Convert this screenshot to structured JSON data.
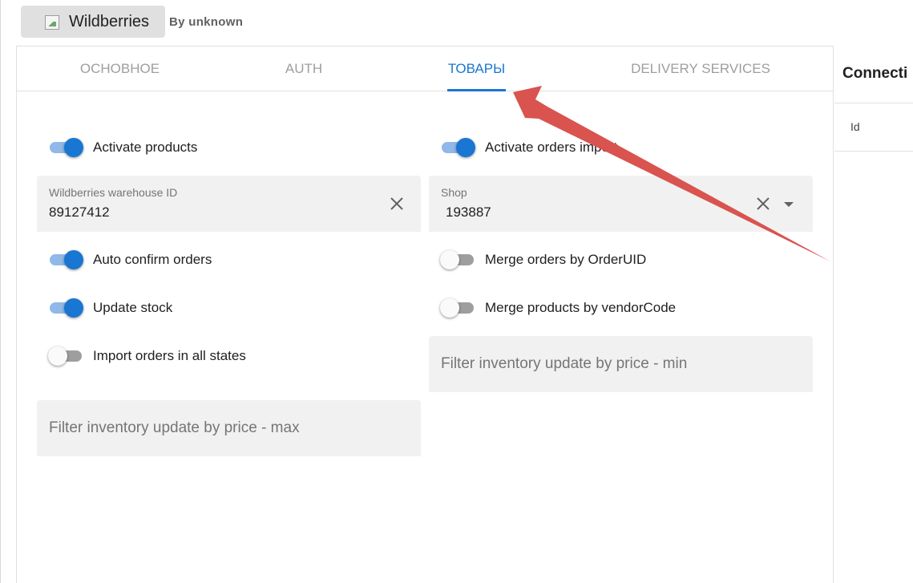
{
  "app": {
    "title": "Wildberries",
    "author": "By unknown"
  },
  "tabs": [
    {
      "label": "ОСНОВНОЕ",
      "active": false
    },
    {
      "label": "AUTH",
      "active": false
    },
    {
      "label": "ТОВАРЫ",
      "active": true
    },
    {
      "label": "DELIVERY SERVICES",
      "active": false
    }
  ],
  "toggles": {
    "activate_products": {
      "label": "Activate products",
      "on": true
    },
    "activate_orders_import": {
      "label": "Activate orders import",
      "on": true
    },
    "auto_confirm_orders": {
      "label": "Auto confirm orders",
      "on": true
    },
    "merge_orders_by_orderuid": {
      "label": "Merge orders by OrderUID",
      "on": false
    },
    "update_stock": {
      "label": "Update stock",
      "on": true
    },
    "merge_products_by_vendorcode": {
      "label": "Merge products by vendorCode",
      "on": false
    },
    "import_orders_all_states": {
      "label": "Import orders in all states",
      "on": false
    }
  },
  "fields": {
    "warehouse_id": {
      "label": "Wildberries warehouse ID",
      "value": "89127412"
    },
    "shop": {
      "label": "Shop",
      "value": "193887"
    },
    "price_min": {
      "placeholder": "Filter inventory update by price - min"
    },
    "price_max": {
      "placeholder": "Filter inventory update by price - max"
    }
  },
  "side_panel": {
    "title": "Connecti",
    "column_id": "Id"
  },
  "colors": {
    "accent": "#1976d2",
    "switch_track_on": "#90b8e8",
    "switch_track_off": "#9e9e9e",
    "field_bg": "#f1f1f1",
    "annotation_arrow": "#d9534f"
  },
  "icons": {
    "clear": "close-icon",
    "dropdown": "chevron-down-icon",
    "app_logo": "broken-image-icon"
  }
}
